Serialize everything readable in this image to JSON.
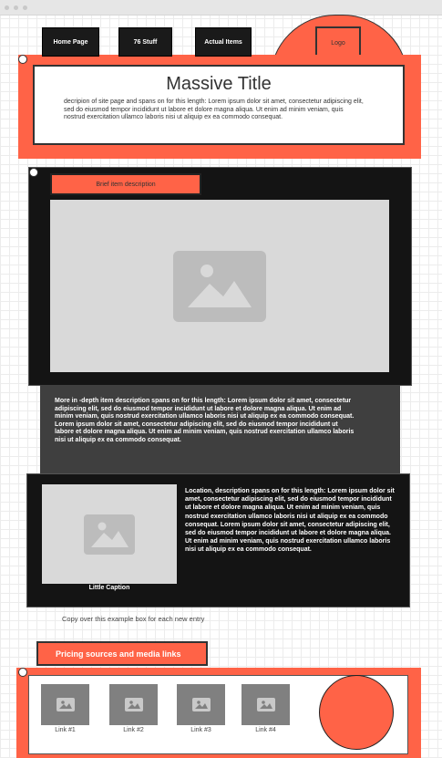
{
  "nav": {
    "items": [
      {
        "label": "Home Page"
      },
      {
        "label": "76 Stuff"
      },
      {
        "label": "Actual Items"
      }
    ],
    "logo": "Logo"
  },
  "header": {
    "title": "Massive Title",
    "description": "decripion of site page and spans on for this length: Lorem ipsum dolor sit amet, consectetur adipiscing elit, sed do eiusmod tempor incididunt ut labore et dolore magna aliqua. Ut enim ad minim veniam, quis nostrud exercitation ullamco laboris nisi ut aliquip ex ea commodo consequat."
  },
  "item": {
    "brief": "Brief item description",
    "in_depth": "More in -depth item description spans on for this length: Lorem ipsum dolor sit amet, consectetur adipiscing elit, sed do eiusmod tempor incididunt ut labore et dolore magna aliqua. Ut enim ad minim veniam, quis nostrud exercitation ullamco laboris nisi ut aliquip ex ea commodo consequat. Lorem ipsum dolor sit amet, consectetur adipiscing elit, sed do eiusmod tempor incididunt ut labore et dolore magna aliqua. Ut enim ad minim veniam, quis nostrud exercitation ullamco laboris nisi ut aliquip ex ea commodo consequat.",
    "location": "Location, description spans on for this length: Lorem ipsum dolor sit amet, consectetur adipiscing elit, sed do eiusmod tempor incididunt ut labore et dolore magna aliqua. Ut enim ad minim veniam, quis nostrud exercitation ullamco laboris nisi ut aliquip ex ea commodo consequat. Lorem ipsum dolor sit amet, consectetur adipiscing elit, sed do eiusmod tempor incididunt ut labore et dolore magna aliqua. Ut enim ad minim veniam, quis nostrud exercitation ullamco laboris nisi ut aliquip ex ea commodo consequat.",
    "caption": "Little Caption"
  },
  "copy_note": "Copy over this example box for each new entry",
  "pricing": {
    "title": "Pricing sources and media links",
    "links": [
      {
        "label": "Link #1"
      },
      {
        "label": "Link #2"
      },
      {
        "label": "Link #3"
      },
      {
        "label": "Link #4"
      }
    ]
  },
  "colors": {
    "accent": "#ff6347",
    "panel_dark": "#141414",
    "panel_gray": "#3f3f3f",
    "image_placeholder": "#d9d9d9"
  },
  "icons": {
    "image": "image-placeholder-icon",
    "logo": "laptop-logo-icon",
    "handle": "drag-handle-icon"
  }
}
